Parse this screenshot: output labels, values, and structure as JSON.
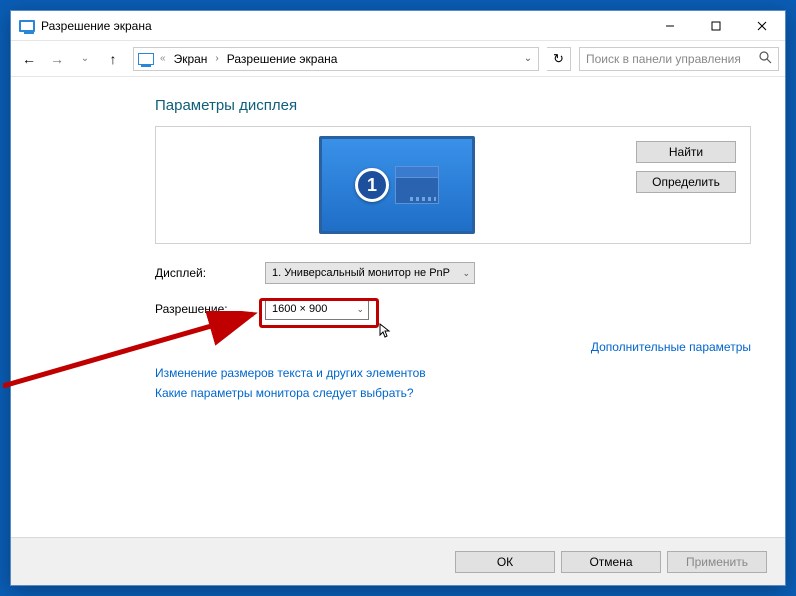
{
  "window": {
    "title": "Разрешение экрана"
  },
  "nav": {
    "breadcrumb_root": "Экран",
    "breadcrumb_page": "Разрешение экрана"
  },
  "search": {
    "placeholder": "Поиск в панели управления"
  },
  "page": {
    "heading": "Параметры дисплея",
    "monitor_label": "1",
    "btn_find": "Найти",
    "btn_identify": "Определить",
    "label_display": "Дисплей:",
    "value_display": "1. Универсальный монитор не PnP",
    "label_resolution": "Разрешение:",
    "value_resolution": "1600 × 900",
    "link_advanced": "Дополнительные параметры",
    "link_textsize": "Изменение размеров текста и других элементов",
    "link_help": "Какие параметры монитора следует выбрать?"
  },
  "footer": {
    "ok": "ОК",
    "cancel": "Отмена",
    "apply": "Применить"
  }
}
